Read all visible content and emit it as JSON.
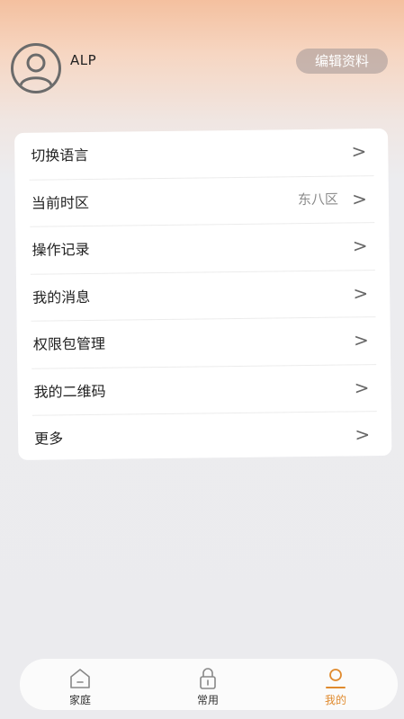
{
  "profile": {
    "username": "ALP",
    "edit_label": "编辑资料"
  },
  "menu": {
    "items": [
      {
        "label": "切换语言",
        "value": ""
      },
      {
        "label": "当前时区",
        "value": "东八区"
      },
      {
        "label": "操作记录",
        "value": ""
      },
      {
        "label": "我的消息",
        "value": ""
      },
      {
        "label": "权限包管理",
        "value": ""
      },
      {
        "label": "我的二维码",
        "value": ""
      },
      {
        "label": "更多",
        "value": ""
      }
    ],
    "chevron": ">"
  },
  "tabbar": {
    "tabs": [
      {
        "label": "家庭",
        "icon": "home-icon"
      },
      {
        "label": "常用",
        "icon": "lock-icon"
      },
      {
        "label": "我的",
        "icon": "profile-icon"
      }
    ],
    "active_index": 2,
    "active_color": "#e08a2d"
  }
}
